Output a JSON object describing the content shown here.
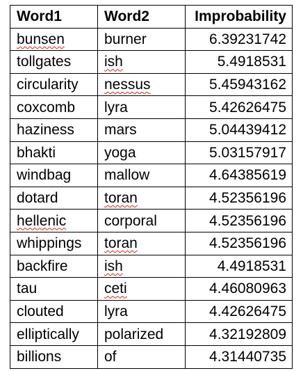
{
  "table": {
    "headers": [
      "Word1",
      "Word2",
      "Improbability"
    ],
    "rows": [
      {
        "word1": "bunsen",
        "word2": "burner",
        "improbability": "6.39231742",
        "flag1": true,
        "flag2": false
      },
      {
        "word1": "tollgates",
        "word2": "ish",
        "improbability": "5.4918531",
        "flag1": false,
        "flag2": true
      },
      {
        "word1": "circularity",
        "word2": "nessus",
        "improbability": "5.45943162",
        "flag1": false,
        "flag2": true
      },
      {
        "word1": "coxcomb",
        "word2": "lyra",
        "improbability": "5.42626475",
        "flag1": false,
        "flag2": false
      },
      {
        "word1": "haziness",
        "word2": "mars",
        "improbability": "5.04439412",
        "flag1": false,
        "flag2": false
      },
      {
        "word1": "bhakti",
        "word2": "yoga",
        "improbability": "5.03157917",
        "flag1": false,
        "flag2": false
      },
      {
        "word1": "windbag",
        "word2": "mallow",
        "improbability": "4.64385619",
        "flag1": false,
        "flag2": false
      },
      {
        "word1": "dotard",
        "word2": "toran",
        "improbability": "4.52356196",
        "flag1": false,
        "flag2": true
      },
      {
        "word1": "hellenic",
        "word2": "corporal",
        "improbability": "4.52356196",
        "flag1": true,
        "flag2": false
      },
      {
        "word1": "whippings",
        "word2": "toran",
        "improbability": "4.52356196",
        "flag1": false,
        "flag2": true
      },
      {
        "word1": "backfire",
        "word2": "ish",
        "improbability": "4.4918531",
        "flag1": false,
        "flag2": true
      },
      {
        "word1": "tau",
        "word2": "ceti",
        "improbability": "4.46080963",
        "flag1": false,
        "flag2": true
      },
      {
        "word1": "clouted",
        "word2": "lyra",
        "improbability": "4.42626475",
        "flag1": false,
        "flag2": false
      },
      {
        "word1": "elliptically",
        "word2": "polarized",
        "improbability": "4.32192809",
        "flag1": false,
        "flag2": false
      },
      {
        "word1": "billions",
        "word2": "of",
        "improbability": "4.31440735",
        "flag1": false,
        "flag2": false
      }
    ]
  },
  "colors": {
    "border": "#000000",
    "text": "#000000",
    "spellcheck_underline": "#e0201a"
  }
}
